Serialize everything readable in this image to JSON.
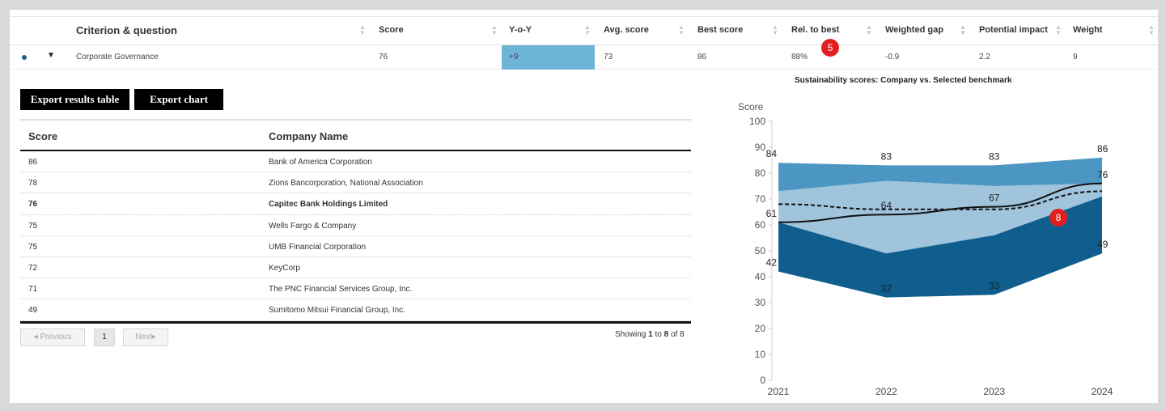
{
  "criterion_table": {
    "headers": [
      "Criterion & question",
      "Score",
      "Y-o-Y",
      "Avg. score",
      "Best score",
      "Rel. to best",
      "Weighted gap",
      "Potential impact",
      "Weight"
    ],
    "row": {
      "name": "Corporate Governance",
      "score": "76",
      "yoy": "+9",
      "avg_score": "73",
      "best_score": "86",
      "rel_to_best": "88%",
      "weighted_gap": "-0.9",
      "potential_impact": "2.2",
      "weight": "9"
    },
    "yoy_highlight_color": "#6db5d6"
  },
  "markers": {
    "header_marker": "5",
    "chart_marker": "8",
    "color": "#e21f1f"
  },
  "buttons": {
    "export_table": "Export results table",
    "export_chart": "Export chart"
  },
  "results_table": {
    "headers": [
      "Score",
      "Company Name"
    ],
    "rows": [
      {
        "score": "86",
        "company": "Bank of America Corporation",
        "highlight": false
      },
      {
        "score": "78",
        "company": "Zions Bancorporation, National Association",
        "highlight": false
      },
      {
        "score": "76",
        "company": "Capitec Bank Holdings Limited",
        "highlight": true
      },
      {
        "score": "75",
        "company": "Wells Fargo & Company",
        "highlight": false
      },
      {
        "score": "75",
        "company": "UMB Financial Corporation",
        "highlight": false
      },
      {
        "score": "72",
        "company": "KeyCorp",
        "highlight": false
      },
      {
        "score": "71",
        "company": "The PNC Financial Services Group, Inc.",
        "highlight": false
      },
      {
        "score": "49",
        "company": "Sumitomo Mitsui Financial Group, Inc.",
        "highlight": false
      }
    ]
  },
  "pagination": {
    "previous": "Previous",
    "page": "1",
    "next": "Next",
    "showing_prefix": "Showing ",
    "from": "1",
    "to_word": " to ",
    "to": "8",
    "of_word": " of ",
    "total": "8"
  },
  "chart_data": {
    "type": "area",
    "title": "Sustainability scores: Company vs. Selected benchmark",
    "ylabel": "Score",
    "x": [
      "2021",
      "2022",
      "2023",
      "2024"
    ],
    "ylim": [
      0,
      100
    ],
    "yticks": [
      0,
      10,
      20,
      30,
      40,
      50,
      60,
      70,
      80,
      90,
      100
    ],
    "bands": [
      {
        "role": "max",
        "values": [
          84,
          83,
          83,
          86
        ],
        "color": "#4b96c3"
      },
      {
        "role": "upper-quartile",
        "values": [
          73,
          77,
          75,
          76
        ],
        "color": "#9fc4dc"
      },
      {
        "role": "lower-quartile",
        "values": [
          61,
          49,
          56,
          71
        ],
        "color": "#0f5e8e"
      },
      {
        "role": "min",
        "values": [
          42,
          32,
          33,
          49
        ]
      }
    ],
    "series": [
      {
        "style": "solid",
        "values": [
          61,
          64,
          67,
          76
        ],
        "color": "#111111"
      },
      {
        "style": "dashed",
        "values": [
          68,
          66,
          66,
          73
        ],
        "color": "#111111"
      }
    ],
    "data_labels": [
      {
        "x": "2021",
        "y": 84,
        "text": "84"
      },
      {
        "x": "2022",
        "y": 83,
        "text": "83"
      },
      {
        "x": "2023",
        "y": 83,
        "text": "83"
      },
      {
        "x": "2024",
        "y": 86,
        "text": "86"
      },
      {
        "x": "2021",
        "y": 61,
        "text": "61"
      },
      {
        "x": "2022",
        "y": 64,
        "text": "64"
      },
      {
        "x": "2023",
        "y": 67,
        "text": "67"
      },
      {
        "x": "2024",
        "y": 76,
        "text": "76"
      },
      {
        "x": "2021",
        "y": 42,
        "text": "42"
      },
      {
        "x": "2022",
        "y": 32,
        "text": "32"
      },
      {
        "x": "2023",
        "y": 33,
        "text": "33"
      },
      {
        "x": "2024",
        "y": 49,
        "text": "49"
      }
    ],
    "grid": false,
    "legend": "none"
  }
}
